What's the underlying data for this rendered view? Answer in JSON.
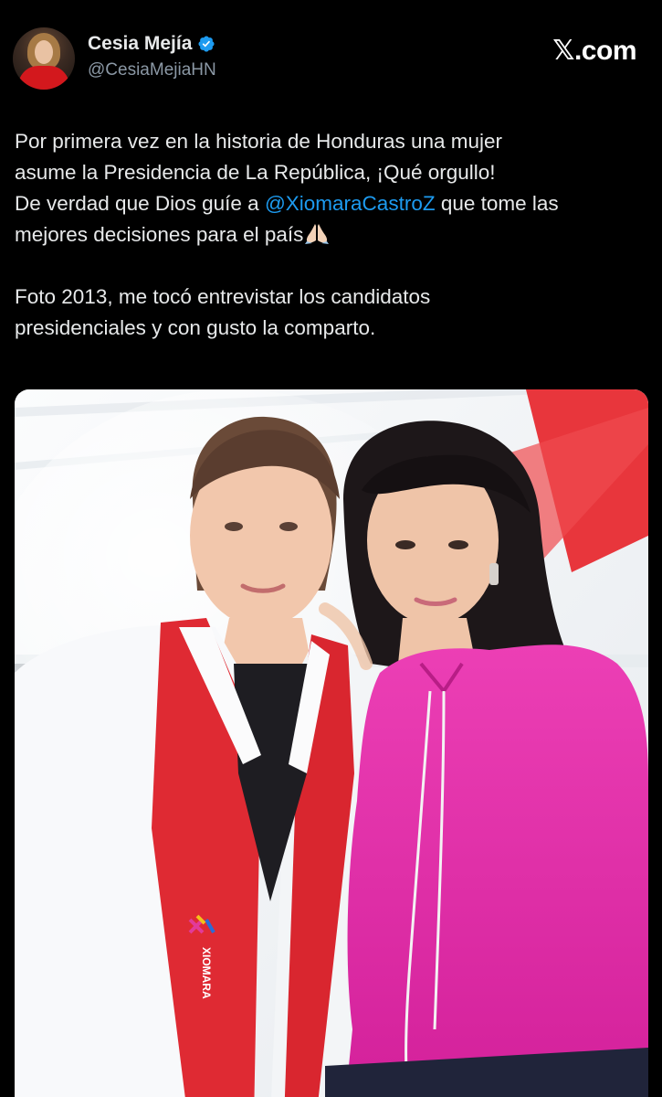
{
  "tweet": {
    "author": {
      "name": "Cesia Mejía",
      "handle": "@CesiaMejiaHN",
      "verified": true
    },
    "brand": {
      "mark": "𝕏",
      "suffix": ".com"
    },
    "text": {
      "line1": "Por primera vez en la historia de Honduras una mujer",
      "line2": "asume la Presidencia de La República, ¡Qué orgullo!",
      "line3_before": "De verdad que Dios guíe a ",
      "mention": "@XiomaraCastroZ",
      "line3_after": " que tome las",
      "line4": "mejores decisiones para el país",
      "line5": "Foto 2013, me tocó entrevistar los candidatos",
      "line6": "presidenciales y con gusto la comparto."
    },
    "photo": {
      "sash_text": "XIOMARA"
    }
  },
  "colors": {
    "background": "#000000",
    "text": "#e7e9ea",
    "secondary_text": "#8b98a5",
    "link": "#1d9bf0",
    "verified": "#1d9bf0"
  },
  "icons": {
    "verified": "verified-badge-icon",
    "emoji": "folded-hands-icon",
    "brand": "x-logo-icon"
  }
}
